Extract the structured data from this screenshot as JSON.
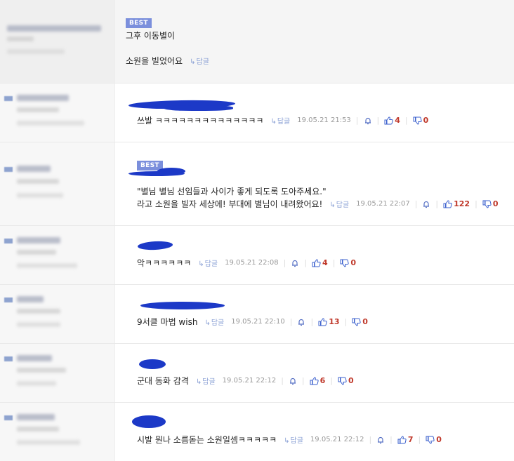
{
  "reply_label": "답글",
  "best_label": "BEST",
  "comments": [
    {
      "lines": [
        "그후 이동별이",
        "소원을 빌었어요"
      ],
      "time": "",
      "up": "",
      "down": "",
      "best": true
    },
    {
      "lines": [
        "쓰발 ㅋㅋㅋㅋㅋㅋㅋㅋㅋㅋㅋㅋㅋㅋ"
      ],
      "time": "19.05.21 21:53",
      "up": "4",
      "down": "0"
    },
    {
      "lines": [
        "\"별님 별님 선임들과 사이가 좋게 되도록 도아주세요.\"",
        "라고 소원을 빌자 세상에! 부대에 별님이 내려왔어요!"
      ],
      "time": "19.05.21 22:07",
      "up": "122",
      "down": "0",
      "best": true
    },
    {
      "lines": [
        "악ㅋㅋㅋㅋㅋㅋ"
      ],
      "time": "19.05.21 22:08",
      "up": "4",
      "down": "0"
    },
    {
      "lines": [
        "9서클 마법 wish"
      ],
      "time": "19.05.21 22:10",
      "up": "13",
      "down": "0"
    },
    {
      "lines": [
        "군대 동화 감격"
      ],
      "time": "19.05.21 22:12",
      "up": "6",
      "down": "0"
    },
    {
      "lines": [
        "시발 뭔나 소름돋는 소원일셈ㅋㅋㅋㅋㅋ"
      ],
      "time": "19.05.21 22:12",
      "up": "7",
      "down": "0"
    }
  ],
  "colors": {
    "accent": "#7b8fdc",
    "reply": "#8aa0d5",
    "vote": "#c0392b",
    "scribble": "#1c39c7"
  },
  "icons": [
    "reply-arrow-icon",
    "bell-icon",
    "thumbs-up-icon",
    "thumbs-down-icon"
  ]
}
